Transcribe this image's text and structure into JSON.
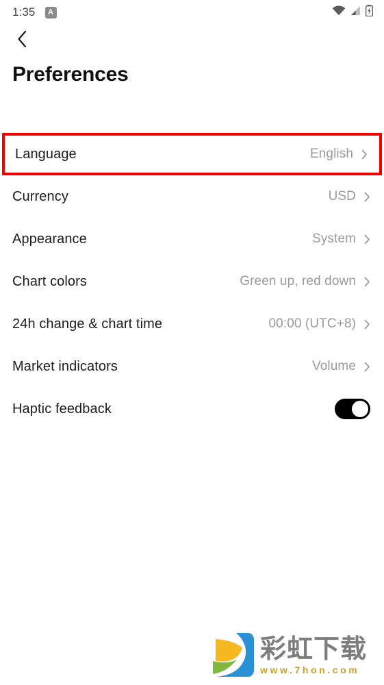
{
  "status_bar": {
    "time": "1:35",
    "app_badge_label": "A",
    "icons": [
      "wifi-icon",
      "cellular-signal-icon",
      "battery-charging-icon"
    ]
  },
  "header": {
    "back_label": "‹",
    "title": "Preferences"
  },
  "settings": {
    "rows": [
      {
        "label": "Language",
        "value": "English",
        "control": "chevron",
        "highlighted": true
      },
      {
        "label": "Currency",
        "value": "USD",
        "control": "chevron",
        "highlighted": false
      },
      {
        "label": "Appearance",
        "value": "System",
        "control": "chevron",
        "highlighted": false
      },
      {
        "label": "Chart colors",
        "value": "Green up, red down",
        "control": "chevron",
        "highlighted": false
      },
      {
        "label": "24h change & chart time",
        "value": "00:00 (UTC+8)",
        "control": "chevron",
        "highlighted": false
      },
      {
        "label": "Market indicators",
        "value": "Volume",
        "control": "chevron",
        "highlighted": false
      },
      {
        "label": "Haptic feedback",
        "value": "",
        "control": "toggle",
        "toggle_on": true,
        "highlighted": false
      }
    ]
  },
  "watermark": {
    "title": "彩虹下载",
    "url": "www.7hon.com"
  },
  "colors": {
    "highlight_border": "#f20000",
    "label_text": "#1c1c1c",
    "value_text": "#9a9a9a",
    "toggle_on": "#000000",
    "watermark_text": "#7d7d7d",
    "watermark_url": "#c9a12a",
    "logo_yellow": "#f5b820",
    "logo_green": "#7fb83c",
    "logo_blue": "#2a91d4",
    "background": "#ffffff"
  }
}
